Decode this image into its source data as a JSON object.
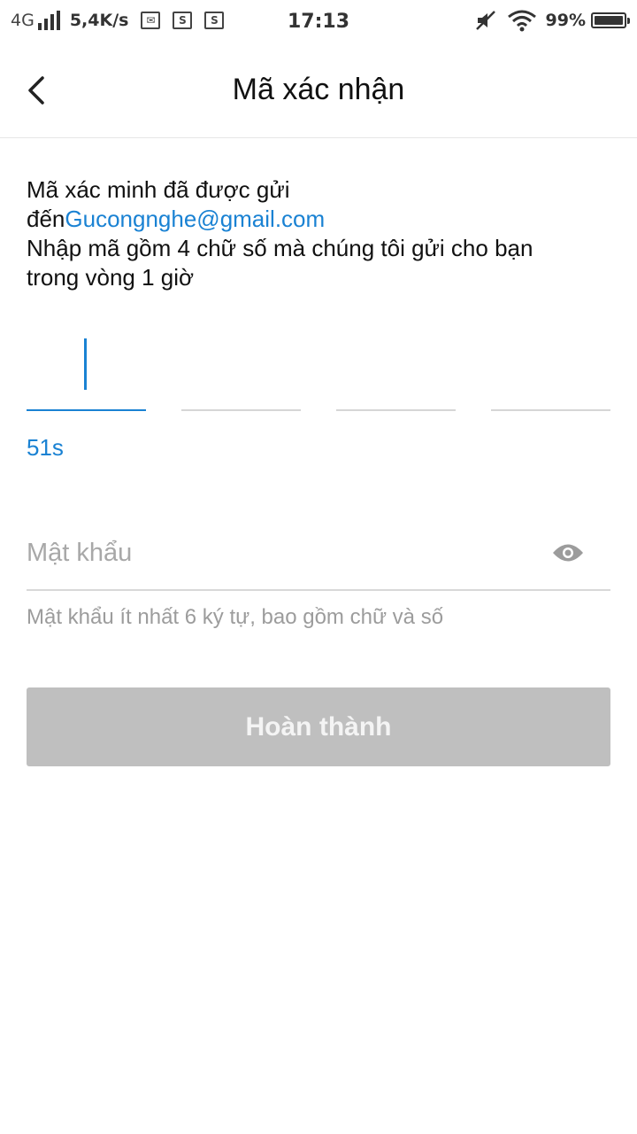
{
  "status_bar": {
    "network": "4G",
    "speed": "5,4K/s",
    "notification_icons": [
      "mail-icon",
      "s-icon",
      "s-icon"
    ],
    "time": "17:13",
    "battery": "99%",
    "battery_level": 0.99
  },
  "header": {
    "title": "Mã xác nhận",
    "back_icon": "chevron-left-icon"
  },
  "info": {
    "line1": "Mã xác minh đã được gửi",
    "prefix": "đến",
    "email": "Gucongnghe@gmail.com",
    "line3": "Nhập mã gồm 4 chữ số mà chúng tôi gửi cho bạn",
    "line4": "trong vòng 1 giờ"
  },
  "code": {
    "length": 4,
    "active_index": 0
  },
  "countdown": "51s",
  "password": {
    "placeholder": "Mật khẩu",
    "value": "",
    "toggle_icon": "eye-icon",
    "hint": "Mật khẩu ít nhất 6 ký tự, bao gồm chữ và số"
  },
  "submit_label": "Hoàn thành",
  "colors": {
    "accent": "#1a82d3",
    "button_disabled": "#bfbfbf"
  }
}
